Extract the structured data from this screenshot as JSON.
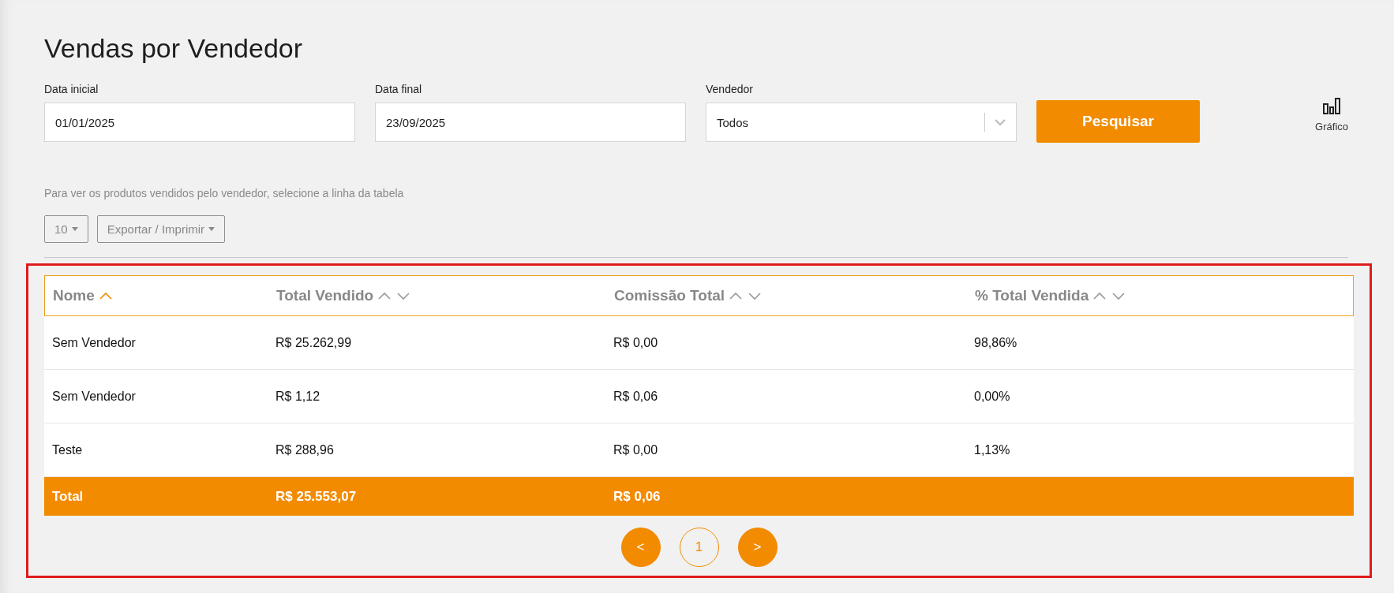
{
  "title": "Vendas por Vendedor",
  "filters": [
    {
      "kind": "input",
      "label": "Data inicial",
      "value": "01/01/2025"
    },
    {
      "kind": "input",
      "label": "Data final",
      "value": "23/09/2025"
    },
    {
      "kind": "select",
      "label": "Vendedor",
      "value": "Todos"
    }
  ],
  "search_button": "Pesquisar",
  "chart_button": "Gráfico",
  "hint": "Para ver os produtos vendidos pelo vendedor, selecione a linha da tabela",
  "page_size_button": "10",
  "export_button": "Exportar / Imprimir",
  "table": {
    "columns": [
      {
        "label": "Nome",
        "sorted": true
      },
      {
        "label": "Total Vendido",
        "sorted": false
      },
      {
        "label": "Comissão Total",
        "sorted": false
      },
      {
        "label": "% Total Vendida",
        "sorted": false
      }
    ],
    "rows": [
      [
        "Sem Vendedor",
        "R$ 25.262,99",
        "R$ 0,00",
        "98,86%"
      ],
      [
        "Sem Vendedor",
        "R$ 1,12",
        "R$ 0,06",
        "0,00%"
      ],
      [
        "Teste",
        "R$ 288,96",
        "R$ 0,00",
        "1,13%"
      ]
    ],
    "total": [
      "Total",
      "R$ 25.553,07",
      "R$ 0,06"
    ]
  },
  "pagination": [
    {
      "label": "<",
      "selected": false
    },
    {
      "label": "1",
      "selected": true
    },
    {
      "label": ">",
      "selected": false
    }
  ]
}
